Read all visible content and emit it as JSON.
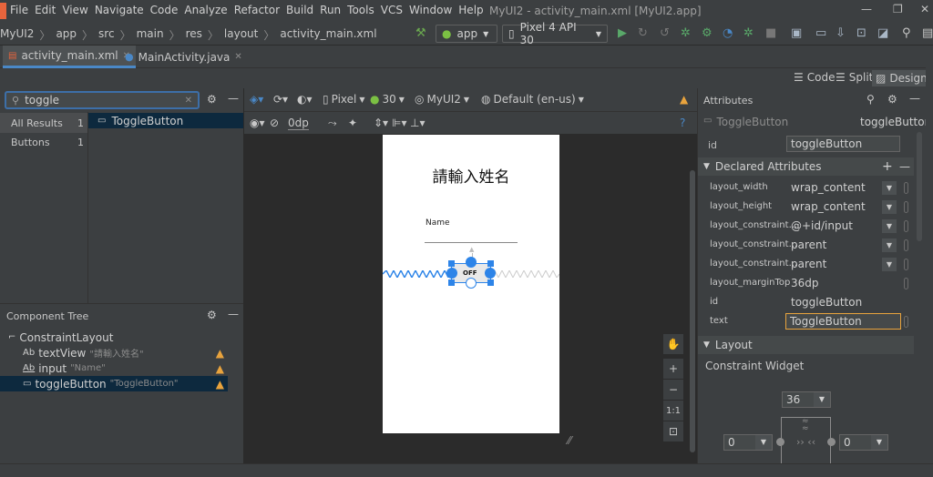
{
  "menu": {
    "items": [
      "File",
      "Edit",
      "View",
      "Navigate",
      "Code",
      "Analyze",
      "Refactor",
      "Build",
      "Run",
      "Tools",
      "VCS",
      "Window",
      "Help"
    ],
    "window_title": "MyUI2 - activity_main.xml [MyUI2.app]"
  },
  "breadcrumbs": [
    "MyUI2",
    "app",
    "src",
    "main",
    "res",
    "layout",
    "activity_main.xml"
  ],
  "run_config": {
    "module": "app",
    "device": "Pixel 4 API 30"
  },
  "tabs": [
    {
      "label": "activity_main.xml",
      "active": true
    },
    {
      "label": "MainActivity.java",
      "active": false
    }
  ],
  "view_modes": {
    "code": "Code",
    "split": "Split",
    "design": "Design",
    "active": "Design"
  },
  "palette": {
    "search_value": "toggle",
    "categories": [
      {
        "label": "All Results",
        "count": "1"
      },
      {
        "label": "Buttons",
        "count": "1"
      }
    ],
    "results": [
      "ToggleButton"
    ]
  },
  "design_toolbar": {
    "device": "Pixel",
    "api": "30",
    "theme": "MyUI2",
    "locale": "Default (en-us)",
    "margin": "0dp"
  },
  "layout_preview": {
    "title_text": "請輸入姓名",
    "name_hint": "Name",
    "toggle_text": "OFF"
  },
  "component_tree": {
    "header": "Component Tree",
    "nodes": [
      {
        "label": "ConstraintLayout",
        "sub": "",
        "prefix": "",
        "warn": false
      },
      {
        "label": "textView",
        "sub": "\"請輸入姓名\"",
        "prefix": "Ab",
        "warn": true
      },
      {
        "label": "input",
        "sub": "\"Name\"",
        "prefix": "Ab",
        "warn": true
      },
      {
        "label": "toggleButton",
        "sub": "\"ToggleButton\"",
        "prefix": "",
        "warn": true
      }
    ]
  },
  "attributes": {
    "header": "Attributes",
    "widget_type": "ToggleButton",
    "widget_id": "toggleButton",
    "id_label": "id",
    "id_value": "toggleButton",
    "declared_header": "Declared Attributes",
    "declared": [
      {
        "key": "layout_width",
        "value": "wrap_content",
        "dropdown": true
      },
      {
        "key": "layout_height",
        "value": "wrap_content",
        "dropdown": true
      },
      {
        "key": "layout_constraint...",
        "value": "@+id/input",
        "dropdown": true
      },
      {
        "key": "layout_constraint...",
        "value": "parent",
        "dropdown": true
      },
      {
        "key": "layout_constraint...",
        "value": "parent",
        "dropdown": true
      },
      {
        "key": "layout_marginTop",
        "value": "36dp",
        "dropdown": false
      },
      {
        "key": "id",
        "value": "toggleButton",
        "dropdown": false
      }
    ],
    "text_label": "text",
    "text_value": "ToggleButton",
    "layout_header": "Layout",
    "constraint_widget": "Constraint Widget",
    "margin_top": "36",
    "margin_left": "0",
    "margin_right": "0"
  },
  "colors": {
    "accent": "#2d84e8",
    "warning": "#e8a33d",
    "selection": "#0d293e"
  }
}
